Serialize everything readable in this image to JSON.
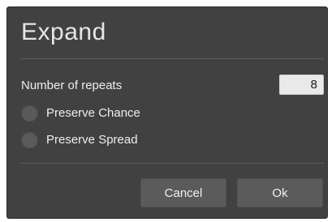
{
  "dialog": {
    "title": "Expand",
    "repeats_label": "Number of repeats",
    "repeats_value": "8",
    "options": [
      {
        "label": "Preserve Chance",
        "checked": false
      },
      {
        "label": "Preserve Spread",
        "checked": false
      }
    ],
    "cancel_label": "Cancel",
    "ok_label": "Ok"
  },
  "colors": {
    "dialog_background": "#414141",
    "button_background": "#5b5b5b",
    "input_background": "#e9e9e9",
    "radio_fill": "#5a5a5a"
  }
}
